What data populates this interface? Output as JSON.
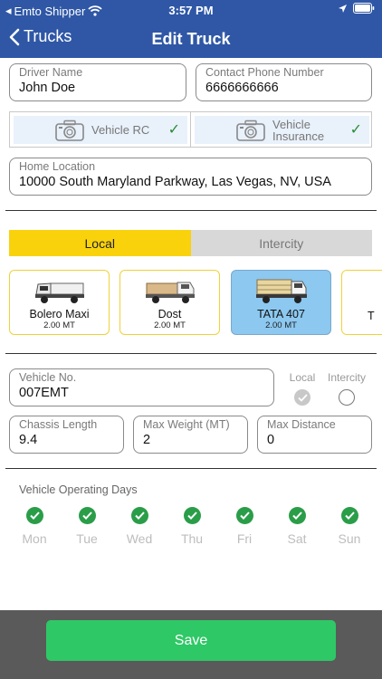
{
  "status": {
    "carrier": "Emto Shipper",
    "time": "3:57 PM"
  },
  "nav": {
    "back_label": "Trucks",
    "title": "Edit Truck"
  },
  "form": {
    "driver_name": {
      "label": "Driver Name",
      "value": "John Doe"
    },
    "contact_phone": {
      "label": "Contact Phone Number",
      "value": "6666666666"
    },
    "home_location": {
      "label": "Home Location",
      "value": "10000 South Maryland Parkway, Las Vegas, NV, USA"
    },
    "vehicle_no": {
      "label": "Vehicle No.",
      "value": "007EMT"
    },
    "chassis_length": {
      "label": "Chassis Length",
      "value": "9.4"
    },
    "max_weight": {
      "label": "Max Weight (MT)",
      "value": "2"
    },
    "max_distance": {
      "label": "Max Distance",
      "value": "0"
    }
  },
  "documents": [
    {
      "label": "Vehicle RC",
      "check": "✓"
    },
    {
      "label_line1": "Vehicle",
      "label_line2": "Insurance",
      "check": "✓"
    }
  ],
  "segment": {
    "options": [
      "Local",
      "Intercity"
    ],
    "selected": "Local"
  },
  "vehicles": [
    {
      "name": "Bolero Maxi",
      "weight": "2.00 MT",
      "selected": false
    },
    {
      "name": "Dost",
      "weight": "2.00 MT",
      "selected": false
    },
    {
      "name": "TATA 407",
      "weight": "2.00 MT",
      "selected": true
    },
    {
      "name": "T",
      "weight": "",
      "selected": false
    }
  ],
  "route_type": {
    "local_label": "Local",
    "intercity_label": "Intercity",
    "selected": "Local"
  },
  "operating_days": {
    "title": "Vehicle Operating Days",
    "days": [
      "Mon",
      "Tue",
      "Wed",
      "Thu",
      "Fri",
      "Sat",
      "Sun"
    ]
  },
  "save_label": "Save",
  "colors": {
    "nav_bar": "#2f57a6",
    "segment_active": "#f9d20c",
    "selected_card": "#8cc8f0",
    "check_green": "#2a9d48",
    "save_button": "#2ec866",
    "footer": "#5a5a5a"
  },
  "icons": [
    "back-chevron-icon",
    "camera-icon",
    "checkmark-icon",
    "wifi-icon",
    "location-arrow-icon",
    "battery-icon",
    "truck-icon"
  ]
}
